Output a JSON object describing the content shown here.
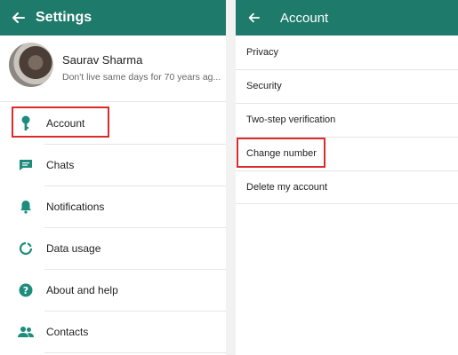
{
  "settings": {
    "title": "Settings",
    "profile": {
      "name": "Saurav Sharma",
      "status": "Don't live same days for 70 years ag..."
    },
    "items": [
      {
        "label": "Account",
        "icon": "key-icon"
      },
      {
        "label": "Chats",
        "icon": "chat-icon"
      },
      {
        "label": "Notifications",
        "icon": "bell-icon"
      },
      {
        "label": "Data usage",
        "icon": "data-usage-icon"
      },
      {
        "label": "About and help",
        "icon": "help-icon"
      },
      {
        "label": "Contacts",
        "icon": "contacts-icon"
      }
    ]
  },
  "account": {
    "title": "Account",
    "items": [
      {
        "label": "Privacy"
      },
      {
        "label": "Security"
      },
      {
        "label": "Two-step verification"
      },
      {
        "label": "Change number"
      },
      {
        "label": "Delete my account"
      }
    ]
  },
  "colors": {
    "appbar": "#1e7a6b",
    "icon": "#1e8c7c",
    "highlight": "#d92b2b"
  }
}
